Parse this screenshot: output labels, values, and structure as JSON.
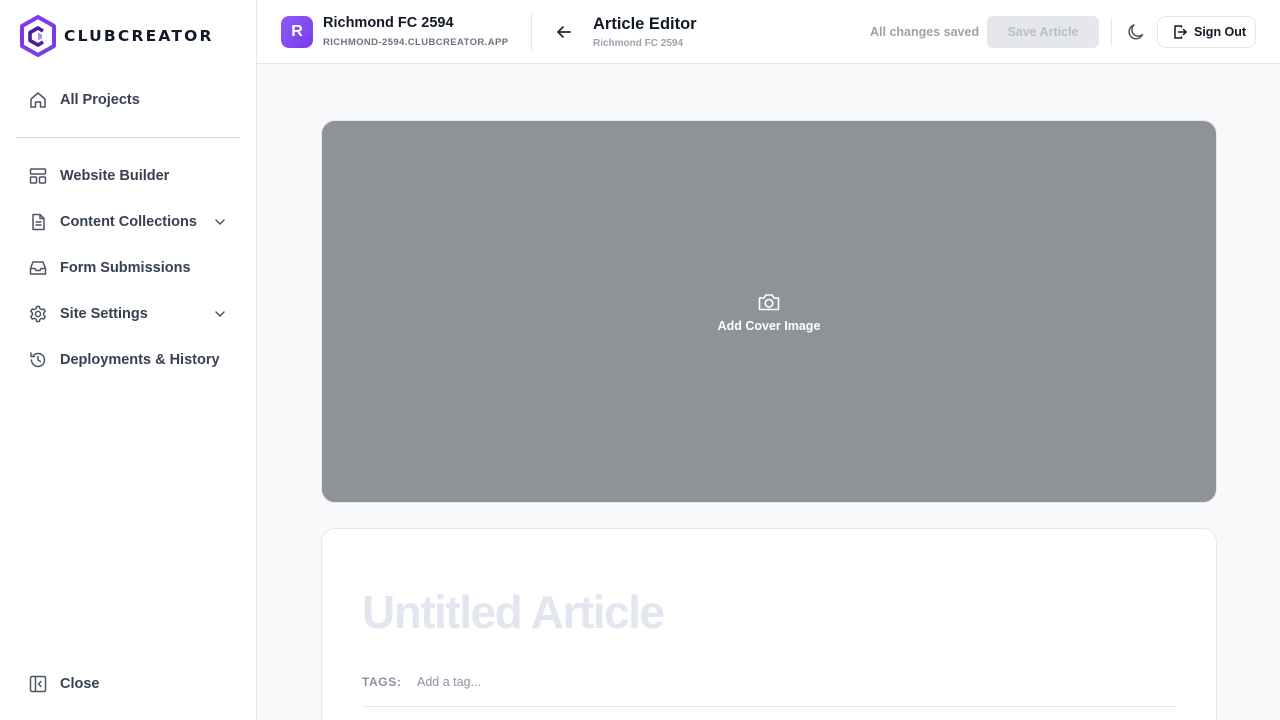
{
  "brand": {
    "name": "CLUBCREATOR",
    "accent": "#7c3aed"
  },
  "sidebar": {
    "items": [
      {
        "label": "All Projects",
        "icon": "home-icon"
      },
      {
        "label": "Website Builder",
        "icon": "layout-icon"
      },
      {
        "label": "Content Collections",
        "icon": "document-icon",
        "expandable": true
      },
      {
        "label": "Form Submissions",
        "icon": "inbox-icon"
      },
      {
        "label": "Site Settings",
        "icon": "gear-icon",
        "expandable": true
      },
      {
        "label": "Deployments & History",
        "icon": "history-icon"
      }
    ],
    "close_label": "Close"
  },
  "header": {
    "project_initial": "R",
    "project_name": "Richmond FC 2594",
    "project_domain": "RICHMOND-2594.CLUBCREATOR.APP",
    "page_title": "Article Editor",
    "page_subtitle": "Richmond FC 2594",
    "save_status": "All changes saved",
    "save_label": "Save Article",
    "signout_label": "Sign Out"
  },
  "editor": {
    "cover_label": "Add Cover Image",
    "title_placeholder": "Untitled Article",
    "title_value": "",
    "tags_label": "TAGS:",
    "tag_placeholder": "Add a tag...",
    "tag_value": ""
  }
}
